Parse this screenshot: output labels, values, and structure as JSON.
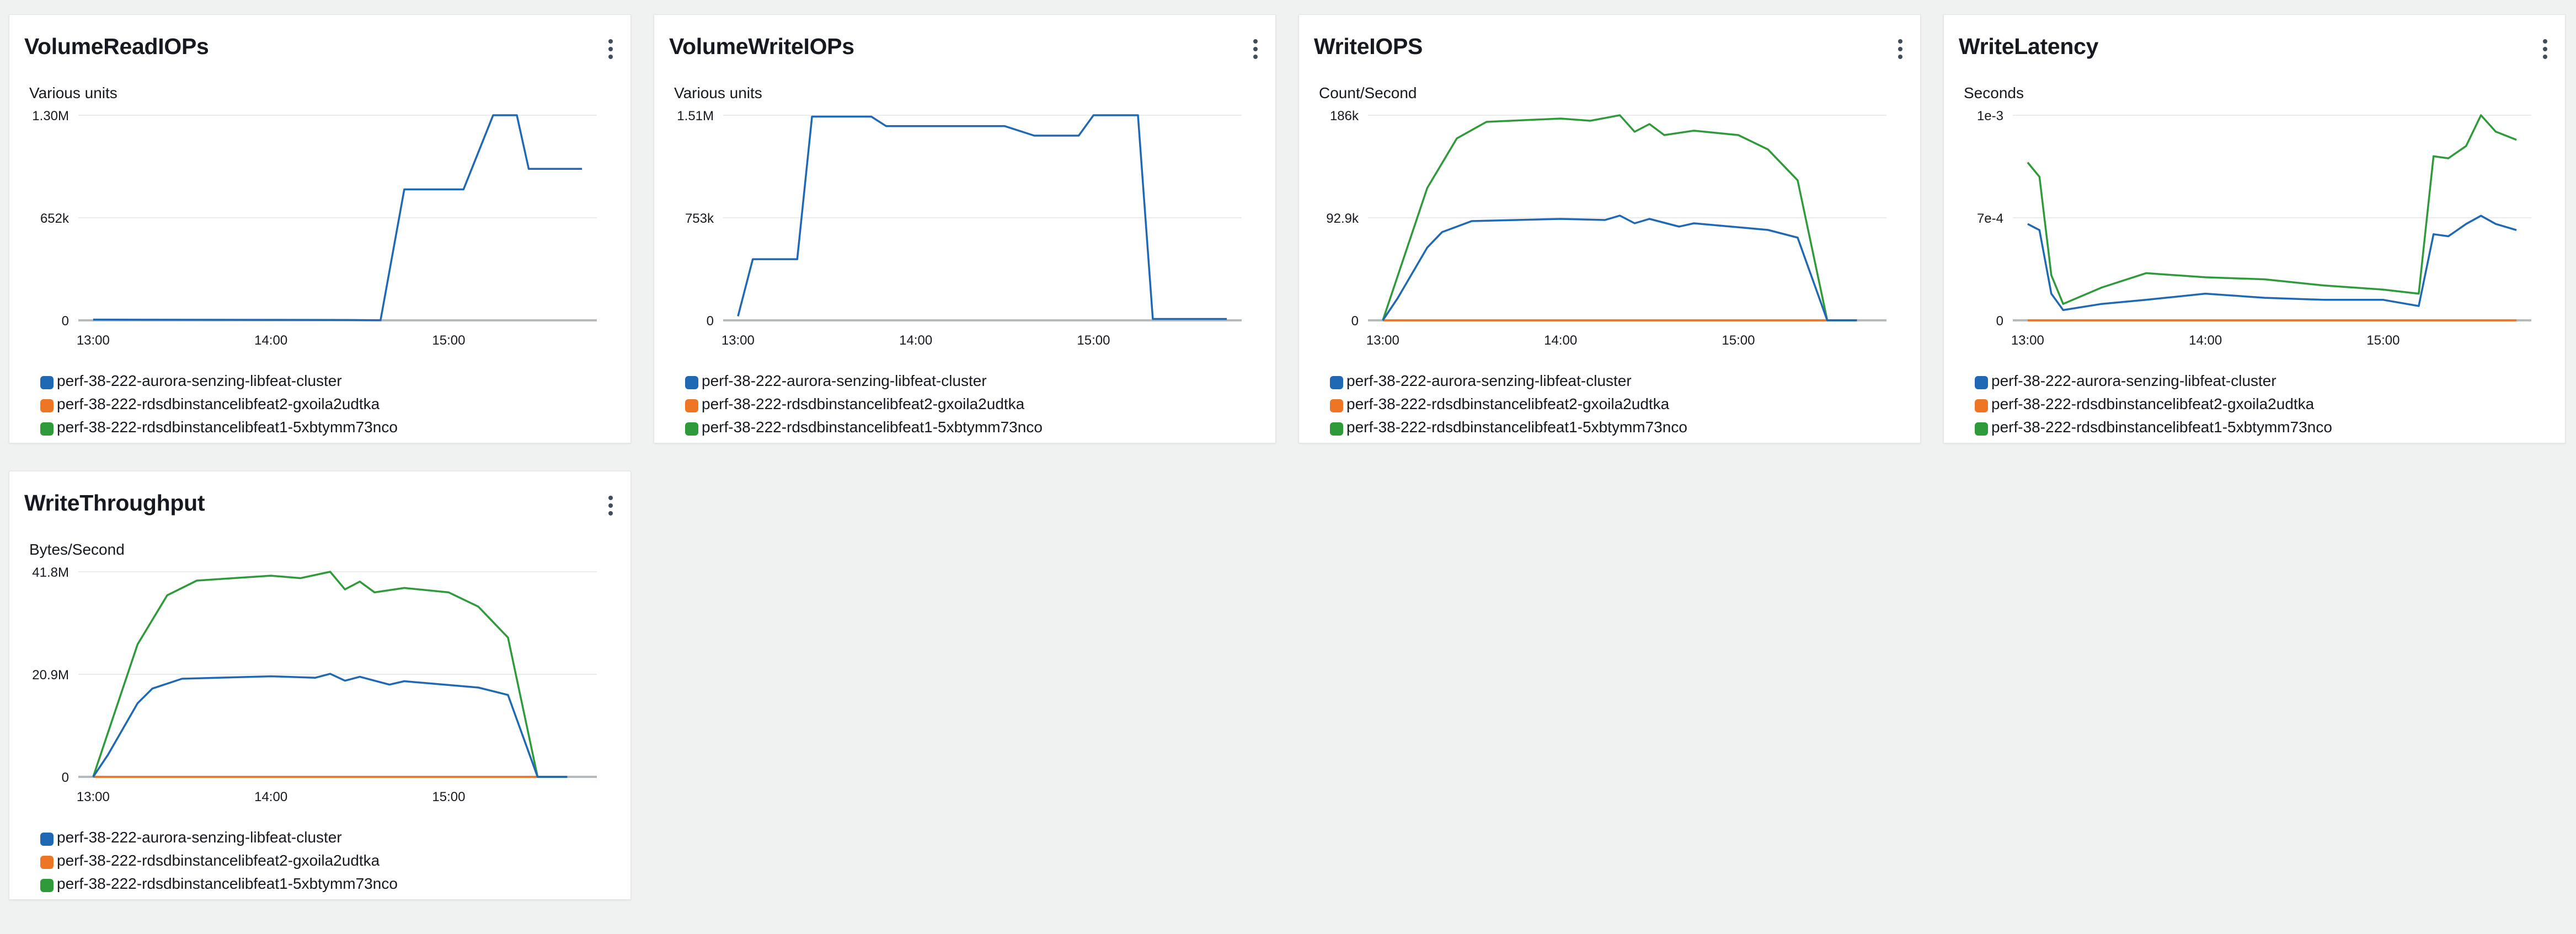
{
  "legend": [
    {
      "label": "perf-38-222-aurora-senzing-libfeat-cluster",
      "color": "#1f69b4"
    },
    {
      "label": "perf-38-222-rdsdbinstancelibfeat2-gxoila2udtka",
      "color": "#ee7524"
    },
    {
      "label": "perf-38-222-rdsdbinstancelibfeat1-5xbtymm73nco",
      "color": "#2f9a3a"
    }
  ],
  "widgets": [
    {
      "title": "VolumeReadIOPs",
      "unit": "Various units",
      "menu_icon": "kebab-menu-icon",
      "chart_data": {
        "type": "line",
        "x_ticks": [
          "13:00",
          "14:00",
          "15:00"
        ],
        "y_ticks": [
          "1.30M",
          "652k",
          "0"
        ],
        "ylim": [
          0,
          1300000
        ],
        "grid": true,
        "legend_position": "bottom",
        "series": [
          {
            "name": "perf-38-222-aurora-senzing-libfeat-cluster",
            "x": [
              "13:00",
              "13:20",
              "13:40",
              "14:00",
              "14:20",
              "14:27",
              "14:32",
              "14:37",
              "14:45",
              "14:55",
              "15:05",
              "15:15",
              "15:23",
              "15:27",
              "15:36",
              "15:45"
            ],
            "values": [
              5000,
              4000,
              3500,
              3000,
              2500,
              2000,
              1500,
              1000,
              830000,
              830000,
              830000,
              1300000,
              1300000,
              960000,
              960000,
              960000
            ]
          },
          {
            "name": "perf-38-222-rdsdbinstancelibfeat2-gxoila2udtka",
            "x": [],
            "values": []
          },
          {
            "name": "perf-38-222-rdsdbinstancelibfeat1-5xbtymm73nco",
            "x": [],
            "values": []
          }
        ]
      }
    },
    {
      "title": "VolumeWriteIOPs",
      "unit": "Various units",
      "menu_icon": "kebab-menu-icon",
      "chart_data": {
        "type": "line",
        "x_ticks": [
          "13:00",
          "14:00",
          "15:00"
        ],
        "y_ticks": [
          "1.51M",
          "753k",
          "0"
        ],
        "ylim": [
          0,
          1510000
        ],
        "grid": true,
        "legend_position": "bottom",
        "series": [
          {
            "name": "perf-38-222-aurora-senzing-libfeat-cluster",
            "x": [
              "13:00",
              "13:05",
              "13:20",
              "13:25",
              "13:45",
              "13:50",
              "14:30",
              "14:40",
              "14:55",
              "15:00",
              "15:15",
              "15:20",
              "15:45"
            ],
            "values": [
              30000,
              450000,
              450000,
              1500000,
              1500000,
              1430000,
              1430000,
              1360000,
              1360000,
              1510000,
              1510000,
              10000,
              10000
            ]
          },
          {
            "name": "perf-38-222-rdsdbinstancelibfeat2-gxoila2udtka",
            "x": [],
            "values": []
          },
          {
            "name": "perf-38-222-rdsdbinstancelibfeat1-5xbtymm73nco",
            "x": [],
            "values": []
          }
        ]
      }
    },
    {
      "title": "WriteIOPS",
      "unit": "Count/Second",
      "menu_icon": "kebab-menu-icon",
      "chart_data": {
        "type": "line",
        "x_ticks": [
          "13:00",
          "14:00",
          "15:00"
        ],
        "y_ticks": [
          "186k",
          "92.9k",
          "0"
        ],
        "ylim": [
          0,
          186000
        ],
        "grid": true,
        "legend_position": "bottom",
        "series": [
          {
            "name": "perf-38-222-aurora-senzing-libfeat-cluster",
            "x": [
              "13:00",
              "13:05",
              "13:15",
              "13:20",
              "13:30",
              "14:00",
              "14:15",
              "14:20",
              "14:25",
              "14:30",
              "14:40",
              "14:45",
              "15:10",
              "15:20",
              "15:30",
              "15:40"
            ],
            "values": [
              0,
              20000,
              66000,
              80000,
              90000,
              92000,
              91000,
              95000,
              88000,
              92000,
              85000,
              88000,
              82000,
              75000,
              0,
              0
            ]
          },
          {
            "name": "perf-38-222-rdsdbinstancelibfeat2-gxoila2udtka",
            "x": [
              "13:00",
              "15:40"
            ],
            "values": [
              0,
              0
            ]
          },
          {
            "name": "perf-38-222-rdsdbinstancelibfeat1-5xbtymm73nco",
            "x": [
              "13:00",
              "13:05",
              "13:15",
              "13:25",
              "13:35",
              "14:00",
              "14:10",
              "14:20",
              "14:25",
              "14:30",
              "14:35",
              "14:45",
              "15:00",
              "15:10",
              "15:20",
              "15:30",
              "15:40"
            ],
            "values": [
              0,
              40000,
              120000,
              165000,
              180000,
              183000,
              181000,
              186000,
              171000,
              178000,
              168000,
              172000,
              168000,
              155000,
              127000,
              0,
              0
            ]
          }
        ]
      }
    },
    {
      "title": "WriteLatency",
      "unit": "Seconds",
      "menu_icon": "kebab-menu-icon",
      "chart_data": {
        "type": "line",
        "x_ticks": [
          "13:00",
          "14:00",
          "15:00"
        ],
        "y_ticks": [
          "1e-3",
          "7e-4",
          "0"
        ],
        "ylim": [
          0,
          0.001
        ],
        "grid": true,
        "legend_position": "bottom",
        "series": [
          {
            "name": "perf-38-222-aurora-senzing-libfeat-cluster",
            "x": [
              "13:00",
              "13:04",
              "13:08",
              "13:12",
              "13:25",
              "13:40",
              "14:00",
              "14:20",
              "14:40",
              "15:00",
              "15:12",
              "15:17",
              "15:22",
              "15:28",
              "15:33",
              "15:38",
              "15:45"
            ],
            "values": [
              0.00047,
              0.00044,
              0.00013,
              5e-05,
              8e-05,
              0.0001,
              0.00013,
              0.00011,
              0.0001,
              0.0001,
              7e-05,
              0.00042,
              0.00041,
              0.00047,
              0.00051,
              0.00047,
              0.00044
            ]
          },
          {
            "name": "perf-38-222-rdsdbinstancelibfeat2-gxoila2udtka",
            "x": [
              "13:00",
              "15:45"
            ],
            "values": [
              0,
              0
            ]
          },
          {
            "name": "perf-38-222-rdsdbinstancelibfeat1-5xbtymm73nco",
            "x": [
              "13:00",
              "13:04",
              "13:08",
              "13:12",
              "13:25",
              "13:40",
              "14:00",
              "14:20",
              "14:40",
              "15:00",
              "15:12",
              "15:17",
              "15:22",
              "15:28",
              "15:33",
              "15:38",
              "15:45"
            ],
            "values": [
              0.00077,
              0.0007,
              0.00022,
              8e-05,
              0.00016,
              0.00023,
              0.00021,
              0.0002,
              0.00017,
              0.00015,
              0.00013,
              0.0008,
              0.00079,
              0.00085,
              0.001,
              0.00092,
              0.00088
            ]
          }
        ]
      }
    },
    {
      "title": "WriteThroughput",
      "unit": "Bytes/Second",
      "menu_icon": "kebab-menu-icon",
      "chart_data": {
        "type": "line",
        "x_ticks": [
          "13:00",
          "14:00",
          "15:00"
        ],
        "y_ticks": [
          "41.8M",
          "20.9M",
          "0"
        ],
        "ylim": [
          0,
          41800000
        ],
        "grid": true,
        "legend_position": "bottom",
        "series": [
          {
            "name": "perf-38-222-aurora-senzing-libfeat-cluster",
            "x": [
              "13:00",
              "13:05",
              "13:15",
              "13:20",
              "13:30",
              "14:00",
              "14:15",
              "14:20",
              "14:25",
              "14:30",
              "14:40",
              "14:45",
              "15:10",
              "15:20",
              "15:30",
              "15:40"
            ],
            "values": [
              0,
              4500000,
              15000000,
              18000000,
              20000000,
              20500000,
              20200000,
              21000000,
              19600000,
              20400000,
              18800000,
              19500000,
              18200000,
              16700000,
              0,
              0
            ]
          },
          {
            "name": "perf-38-222-rdsdbinstancelibfeat2-gxoila2udtka",
            "x": [
              "13:00",
              "15:40"
            ],
            "values": [
              0,
              0
            ]
          },
          {
            "name": "perf-38-222-rdsdbinstancelibfeat1-5xbtymm73nco",
            "x": [
              "13:00",
              "13:05",
              "13:15",
              "13:25",
              "13:35",
              "14:00",
              "14:10",
              "14:20",
              "14:25",
              "14:30",
              "14:35",
              "14:45",
              "15:00",
              "15:10",
              "15:20",
              "15:30",
              "15:40"
            ],
            "values": [
              0,
              9000000,
              27000000,
              37000000,
              40000000,
              41000000,
              40500000,
              41800000,
              38200000,
              39800000,
              37600000,
              38500000,
              37600000,
              34700000,
              28400000,
              0,
              0
            ]
          }
        ]
      }
    }
  ]
}
